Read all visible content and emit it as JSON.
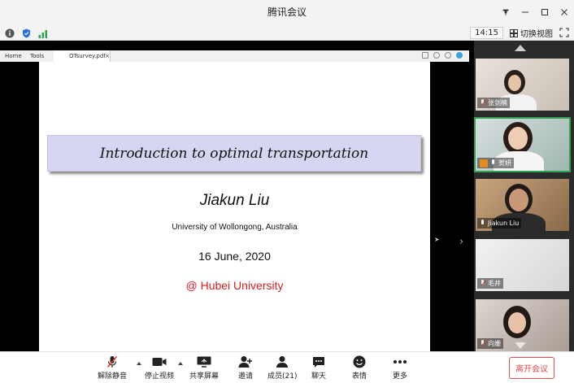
{
  "window": {
    "title": "腾讯会议"
  },
  "statusbar": {
    "time": "14:15",
    "switch_view_label": "切换视图"
  },
  "pdf_viewer": {
    "menu": [
      "Home",
      "Tools"
    ],
    "file_tab": "OTsurvey.pdf",
    "close_glyph": "×"
  },
  "slide": {
    "title": "Introduction to optimal transportation",
    "author": "Jiakun Liu",
    "affiliation": "University of Wollongong,  Australia",
    "date": "16 June, 2020",
    "venue": "@ Hubei University"
  },
  "participants": [
    {
      "name": "张剑楠",
      "mic": "muted"
    },
    {
      "name": "贺妍",
      "mic": "on",
      "host": true
    },
    {
      "name": "Jiakun Liu",
      "mic": "on"
    },
    {
      "name": "毛井",
      "mic": "muted"
    },
    {
      "name": "向姗",
      "mic": "muted"
    }
  ],
  "toolbar": {
    "unmute": "解除静音",
    "stop_video": "停止视频",
    "share_screen": "共享屏幕",
    "invite": "邀请",
    "members": "成员(21)",
    "chat": "聊天",
    "emoji": "表情",
    "more": "更多",
    "leave": "离开会议"
  },
  "colors": {
    "accent_red": "#e14a4a",
    "active_border": "#2fa34f",
    "banner": "#d6d6f2",
    "venue_red": "#d42020"
  }
}
